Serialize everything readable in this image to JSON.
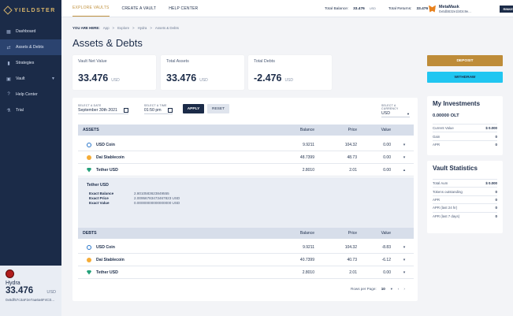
{
  "sidebar": {
    "logo": "YIELDSTER",
    "items": [
      {
        "label": "Dashboard",
        "icon": "grid-icon"
      },
      {
        "label": "Assets & Debts",
        "icon": "coins-icon"
      },
      {
        "label": "Strategies",
        "icon": "chart-icon"
      },
      {
        "label": "Vault",
        "icon": "safe-icon"
      },
      {
        "label": "Help Center",
        "icon": "help-icon"
      },
      {
        "label": "Trial",
        "icon": "flask-icon"
      }
    ],
    "vault_card": {
      "name": "Hydra",
      "amount": "33.476",
      "currency": "USD",
      "address": "0x6df57c3aF2e7aa6a6F4C0..."
    }
  },
  "topbar": {
    "nav": [
      "EXPLORE VAULTS",
      "CREATE A VAULT",
      "HELP CENTER"
    ],
    "total_balance_label": "Total Balance:",
    "total_balance_value": "33.476",
    "total_balance_unit": "USD",
    "total_returns_label": "Total Returns:",
    "total_returns_value": "33.476",
    "total_returns_unit": "%",
    "wallet_name": "MetaMask",
    "wallet_addr": "0x6dbB32e1b03c9e...",
    "network": "RINKEBY"
  },
  "breadcrumb": {
    "label": "YOU ARE HERE:",
    "path": [
      "App",
      ">",
      "Explore",
      ">",
      "Hydra",
      ">",
      "Assets & Debts"
    ]
  },
  "page_title": "Assets & Debts",
  "stats": [
    {
      "label": "Vault Net Value",
      "value": "33.476",
      "cur": "USD"
    },
    {
      "label": "Total Assets",
      "value": "33.476",
      "cur": "USD"
    },
    {
      "label": "Total Debts",
      "value": "-2.476",
      "cur": "USD"
    }
  ],
  "filters": {
    "date_label": "SELECT A DATE",
    "date_value": "September 30th 2021",
    "time_label": "SELECT A TIME",
    "time_value": "01:50 pm",
    "apply": "APPLY",
    "reset": "RESET",
    "currency_label": "SELECT A CURRENCY",
    "currency_value": "USD"
  },
  "columns": {
    "balance": "Balance",
    "price": "Price",
    "value": "Value"
  },
  "assets": {
    "title": "ASSETS",
    "rows": [
      {
        "name": "USD Coin",
        "balance": "9.9211",
        "price": "104.32",
        "value": "0.00"
      },
      {
        "name": "Dai Stablecoin",
        "balance": "48.7399",
        "price": "48.73",
        "value": "0.00"
      },
      {
        "name": "Tether USD",
        "balance": "2.8010",
        "price": "2.01",
        "value": "0.00"
      }
    ],
    "detail": {
      "title": "Tether USD",
      "lines": [
        {
          "label": "Exact Balance",
          "value": "2.8010583623849555"
        },
        {
          "label": "Exact Price",
          "value": "2.00956783473467823 USD"
        },
        {
          "label": "Exact Value",
          "value": "0.00000000000000000 USD"
        }
      ]
    }
  },
  "debts": {
    "title": "DEBTS",
    "rows": [
      {
        "name": "USD Coin",
        "balance": "9.9211",
        "price": "104.32",
        "value": "-8.83"
      },
      {
        "name": "Dai Stablecoin",
        "balance": "40.7399",
        "price": "40.73",
        "value": "-6.12"
      },
      {
        "name": "Tether USD",
        "balance": "2.8010",
        "price": "2.01",
        "value": "0.00"
      }
    ]
  },
  "pager": {
    "label": "Rows per Page:",
    "value": "10",
    "prev": "‹",
    "next": "›"
  },
  "actions": {
    "deposit": "DEPOSIT",
    "withdraw": "WITHDRAW"
  },
  "investments": {
    "title": "My Investments",
    "amount": "0.00000 OLT",
    "lines": [
      {
        "label": "Current Value",
        "value": "$ 0.000"
      },
      {
        "label": "Gain",
        "value": "0"
      },
      {
        "label": "APR",
        "value": "0"
      }
    ]
  },
  "vault_stats": {
    "title": "Vault Statistics",
    "lines": [
      {
        "label": "Total Aum",
        "value": "$ 0.000"
      },
      {
        "label": "Tokens outstanding",
        "value": "0"
      },
      {
        "label": "APR",
        "value": "0"
      },
      {
        "label": "APR (last 24 hr)",
        "value": "0"
      },
      {
        "label": "APR (last 7 days)",
        "value": "0"
      }
    ]
  }
}
